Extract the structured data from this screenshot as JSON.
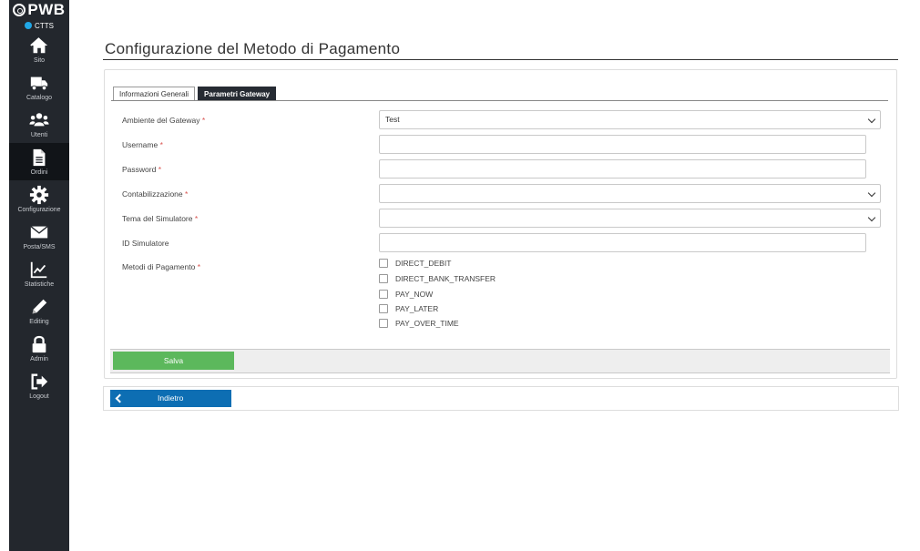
{
  "sidebar": {
    "brand": "PWB",
    "site_badge": "CTTS",
    "items": [
      {
        "label": "Sito",
        "icon": "home-icon"
      },
      {
        "label": "Catalogo",
        "icon": "truck-icon"
      },
      {
        "label": "Utenti",
        "icon": "users-icon"
      },
      {
        "label": "Ordini",
        "icon": "document-icon",
        "active": true
      },
      {
        "label": "Configurazione",
        "icon": "gear-icon"
      },
      {
        "label": "Posta/SMS",
        "icon": "envelope-icon"
      },
      {
        "label": "Statistiche",
        "icon": "chart-icon"
      },
      {
        "label": "Editing",
        "icon": "pencil-icon"
      },
      {
        "label": "Admin",
        "icon": "lock-icon"
      },
      {
        "label": "Logout",
        "icon": "logout-icon"
      }
    ],
    "active_color": "#111418",
    "badge_color": "#20a7e6"
  },
  "page": {
    "title": "Configurazione del Metodo di Pagamento"
  },
  "tabs": [
    {
      "label": "Informazioni Generali",
      "active": false
    },
    {
      "label": "Parametri Gateway",
      "active": true
    }
  ],
  "form": {
    "ambiente": {
      "label": "Ambiente del Gateway",
      "required": "*",
      "value": "Test"
    },
    "username": {
      "label": "Username",
      "required": "*",
      "value": ""
    },
    "password": {
      "label": "Password",
      "required": "*",
      "value": ""
    },
    "contabilizzazione": {
      "label": "Contabilizzazione",
      "required": "*",
      "value": ""
    },
    "tema": {
      "label": "Tema del Simulatore",
      "required": "*",
      "value": ""
    },
    "id_simulatore": {
      "label": "ID Simulatore",
      "value": ""
    },
    "metodi": {
      "label": "Metodi di Pagamento",
      "required": "*",
      "options": [
        {
          "label": "DIRECT_DEBIT",
          "checked": false
        },
        {
          "label": "DIRECT_BANK_TRANSFER",
          "checked": false
        },
        {
          "label": "PAY_NOW",
          "checked": false
        },
        {
          "label": "PAY_LATER",
          "checked": false
        },
        {
          "label": "PAY_OVER_TIME",
          "checked": false
        }
      ]
    }
  },
  "actions": {
    "save_label": "Salva",
    "save_color": "#5cb85c",
    "back_label": "Indietro",
    "back_color": "#0d6eb3"
  }
}
